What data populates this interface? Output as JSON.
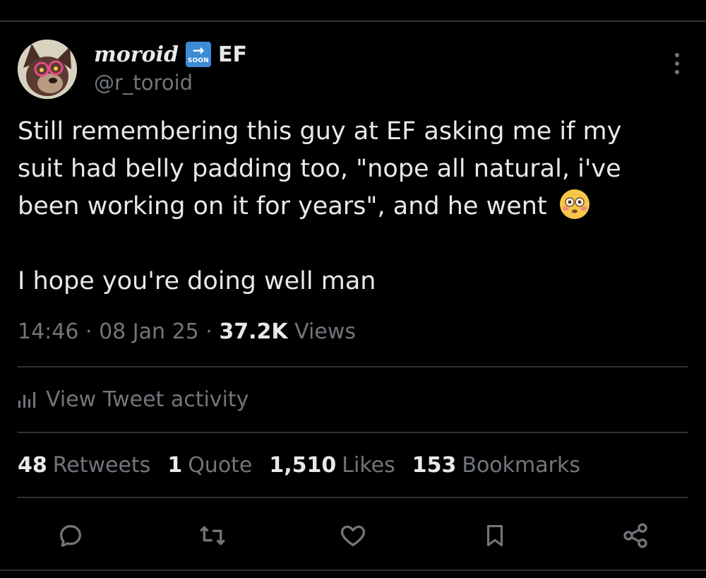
{
  "user": {
    "display_name": "тoroid",
    "badge_text": "SOON",
    "badge_arrow": "→",
    "name_suffix": "EF",
    "handle": "@r_toroid"
  },
  "tweet": {
    "text_line1": "Still remembering this guy at EF asking me if my",
    "text_line2": "suit had belly padding too, \"nope all natural, i've",
    "text_line3": "been working on it for years\", and he went ",
    "text_line4": "I hope you're doing well man",
    "emoji": "flushed-face"
  },
  "meta": {
    "time": "14:46",
    "sep1": " · ",
    "date": "08 Jan 25",
    "sep2": " · ",
    "views_count": "37.2K",
    "views_label": " Views"
  },
  "activity": {
    "label": "View Tweet activity"
  },
  "stats": [
    {
      "count": "48",
      "label": "Retweets"
    },
    {
      "count": "1",
      "label": "Quote"
    },
    {
      "count": "1,510",
      "label": "Likes"
    },
    {
      "count": "153",
      "label": "Bookmarks"
    }
  ],
  "colors": {
    "background": "#000000",
    "text": "#e7e9ea",
    "secondary": "#71767b",
    "divider": "#2f3336",
    "badge": "#3d8ad6"
  }
}
